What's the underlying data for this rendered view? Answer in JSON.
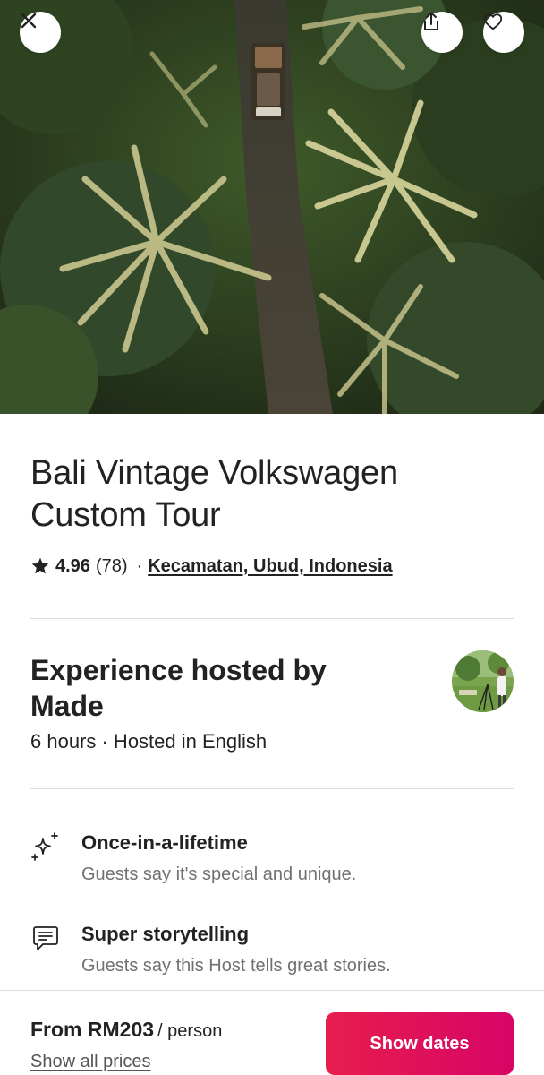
{
  "listing": {
    "title": "Bali Vintage Volkswagen Custom Tour",
    "rating": "4.96",
    "reviews": "(78)",
    "separator": "·",
    "location": "Kecamatan, Ubud, Indonesia"
  },
  "host": {
    "title": "Experience hosted by Made",
    "details": "6 hours · Hosted in English"
  },
  "highlights": [
    {
      "icon": "sparkles-icon",
      "title": "Once-in-a-lifetime",
      "description": "Guests say it's special and unique."
    },
    {
      "icon": "chat-bubble-icon",
      "title": "Super storytelling",
      "description": "Guests say this Host tells great stories."
    }
  ],
  "footer": {
    "price": "From RM203",
    "unit": "/ person",
    "all_prices_link": "Show all prices",
    "cta": "Show dates"
  },
  "top_actions": {
    "close_icon": "close-icon",
    "share_icon": "share-icon",
    "favorite_icon": "heart-icon"
  },
  "colors": {
    "accent": "#e61e4d",
    "accent_end": "#d70466",
    "text": "#222222",
    "muted": "#717171",
    "divider": "#dddddd"
  }
}
